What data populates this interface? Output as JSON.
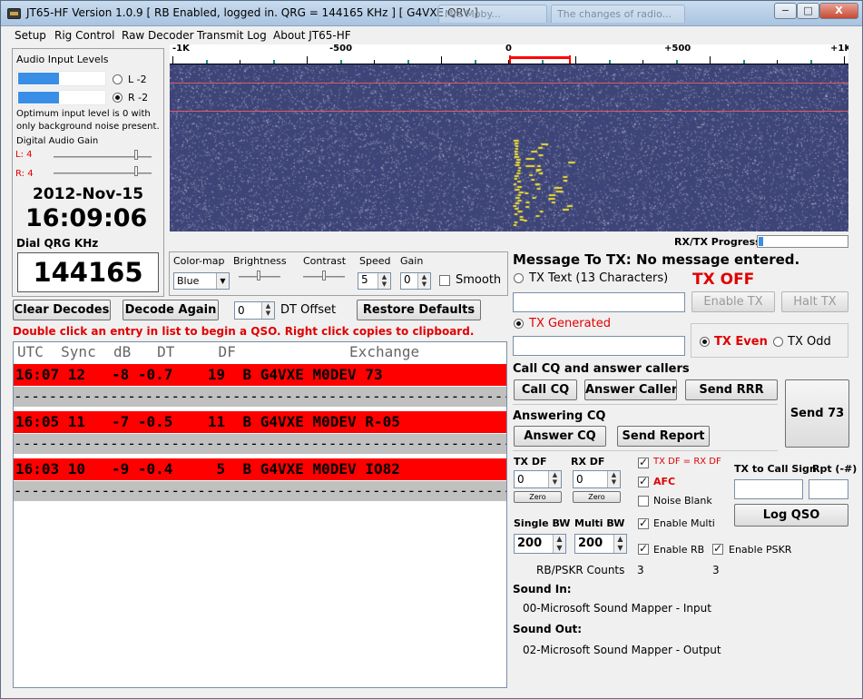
{
  "window": {
    "title": "JT65-HF Version 1.0.9  [ RB Enabled, logged in.  QRG = 144165 KHz ] [ G4VXE QRV ]",
    "bg_tabs": [
      "Mrs Moby...",
      "The changes of radio..."
    ],
    "min_label": "−",
    "max_label": "□",
    "close_label": "X"
  },
  "menu": [
    "Setup",
    "Rig Control",
    "Raw Decoder",
    "Transmit Log",
    "About JT65-HF"
  ],
  "audio": {
    "title": "Audio Input Levels",
    "left_label": "L -2",
    "right_label": "R -2",
    "left_level": 0.46,
    "right_level": 0.46,
    "note_line1": "Optimum input level is 0 with",
    "note_line2": "only background noise present.",
    "gain_title": "Digital Audio Gain",
    "gain_l": "L: 4",
    "gain_r": "R: 4"
  },
  "clock": {
    "date": "2012-Nov-15",
    "time": "16:09:06"
  },
  "dial": {
    "label": "Dial QRG KHz",
    "value": "144165"
  },
  "waterfall": {
    "scale_labels": [
      "-1K",
      "-500",
      "0",
      "+500",
      "+1K"
    ],
    "progress_label": "RX/TX Progress",
    "progress": 0.05
  },
  "controls": {
    "colormap_label": "Color-map",
    "colormap_value": "Blue",
    "brightness_label": "Brightness",
    "contrast_label": "Contrast",
    "speed_label": "Speed",
    "speed_value": "5",
    "gain_label": "Gain",
    "gain_value": "0",
    "smooth_label": "Smooth"
  },
  "decoder": {
    "clear_label": "Clear Decodes",
    "again_label": "Decode Again",
    "dt_value": "0",
    "dt_label": "DT Offset",
    "restore_label": "Restore Defaults",
    "hint": "Double click an entry in list to begin a QSO.  Right click copies to clipboard."
  },
  "table": {
    "header": "UTC  Sync  dB   DT     DF             Exchange",
    "rows": [
      "16:07 12   -8 -0.7    19  B G4VXE M0DEV 73",
      "16:05 11   -7 -0.5    11  B G4VXE M0DEV R-05",
      "16:03 10   -9 -0.4     5  B G4VXE M0DEV IO82"
    ],
    "separator": "----------------------------------------------------------------------------"
  },
  "tx": {
    "message_title": "Message To TX:  No message entered.",
    "text_label": "TX Text (13 Characters)",
    "tx_off": "TX OFF",
    "enable_label": "Enable TX",
    "halt_label": "Halt TX",
    "generated_label": "TX Generated",
    "even_label": "TX Even",
    "odd_label": "TX Odd"
  },
  "qso": {
    "cq_title": "Call CQ and answer callers",
    "call_cq": "Call CQ",
    "answer_caller": "Answer Caller",
    "send_rrr": "Send RRR",
    "send_73": "Send 73",
    "answering_title": "Answering CQ",
    "answer_cq": "Answer CQ",
    "send_report": "Send Report"
  },
  "params": {
    "txdf_label": "TX DF",
    "txdf_value": "0",
    "rxdf_label": "RX DF",
    "rxdf_value": "0",
    "zero_label": "Zero",
    "txdf_eq_rxdf": "TX DF = RX DF",
    "afc": "AFC",
    "noise_blank": "Noise Blank",
    "enable_multi": "Enable Multi",
    "single_bw_label": "Single BW",
    "single_bw_value": "200",
    "multi_bw_label": "Multi BW",
    "multi_bw_value": "200",
    "enable_rb": "Enable RB",
    "enable_pskr": "Enable PSKR",
    "counts_label": "RB/PSKR Counts",
    "rb_count": "3",
    "pskr_count": "3",
    "tx_to_call_label": "TX to Call Sign",
    "rpt_label": "Rpt (-#)",
    "log_qso": "Log QSO"
  },
  "sound": {
    "in_label": "Sound In:",
    "in_device": "00-Microsoft Sound Mapper - Input",
    "out_label": "Sound Out:",
    "out_device": "02-Microsoft Sound Mapper - Output"
  },
  "colors": {
    "decode_row": "#ff0000",
    "accent_red": "#e00000",
    "waterfall_bg": "#3d4478",
    "signal": "#f0e030"
  }
}
